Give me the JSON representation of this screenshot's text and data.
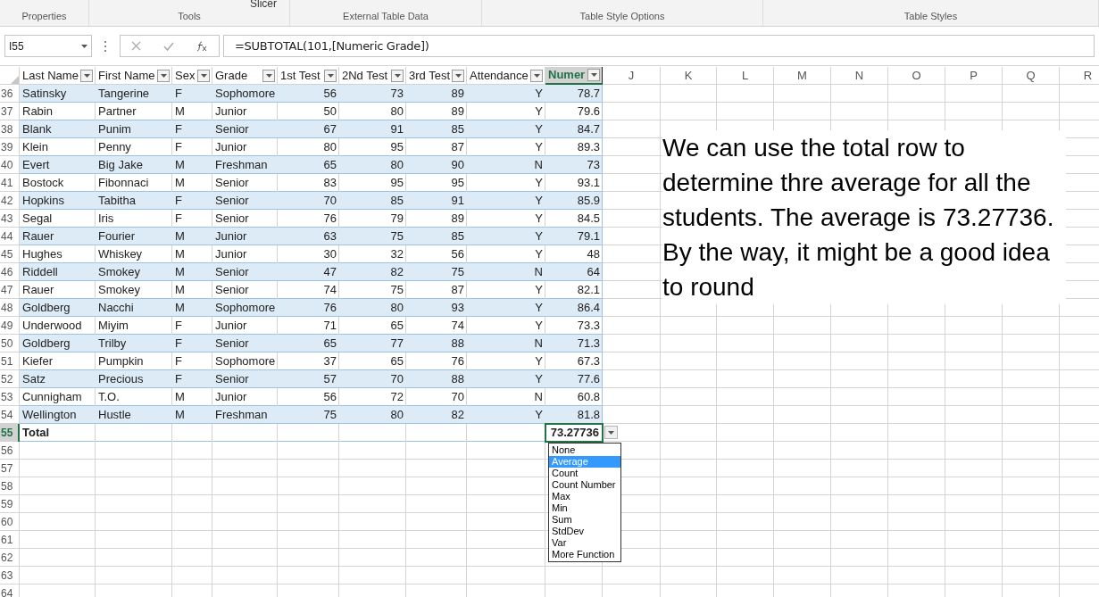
{
  "ribbon": {
    "slicer_label": "Slicer",
    "groups": [
      "Properties",
      "Tools",
      "External Table Data",
      "Table Style Options",
      "Table Styles"
    ]
  },
  "formula_bar": {
    "name_box": "I55",
    "formula": "=SUBTOTAL(101,[Numeric Grade])"
  },
  "columns": [
    {
      "label": "Last Name",
      "filter": true,
      "selected": false
    },
    {
      "label": "First Name",
      "filter": true,
      "selected": false
    },
    {
      "label": "Sex",
      "filter": true,
      "selected": false
    },
    {
      "label": "Grade",
      "filter": true,
      "selected": false
    },
    {
      "label": "1st Test",
      "filter": true,
      "selected": false
    },
    {
      "label": "2Nd Test",
      "filter": true,
      "selected": false
    },
    {
      "label": "3rd Test",
      "filter": true,
      "selected": false
    },
    {
      "label": "Attendance",
      "filter": true,
      "selected": false
    },
    {
      "label": "Numer",
      "filter": true,
      "selected": true
    },
    {
      "label": "J",
      "filter": false,
      "selected": false
    },
    {
      "label": "K",
      "filter": false,
      "selected": false
    },
    {
      "label": "L",
      "filter": false,
      "selected": false
    },
    {
      "label": "M",
      "filter": false,
      "selected": false
    },
    {
      "label": "N",
      "filter": false,
      "selected": false
    },
    {
      "label": "O",
      "filter": false,
      "selected": false
    },
    {
      "label": "P",
      "filter": false,
      "selected": false
    },
    {
      "label": "Q",
      "filter": false,
      "selected": false
    },
    {
      "label": "R",
      "filter": false,
      "selected": false
    }
  ],
  "rows": [
    {
      "num": "36",
      "cells": [
        "Satinsky",
        "Tangerine",
        "F",
        "Sophomore",
        "56",
        "73",
        "89",
        "Y",
        "78.7"
      ]
    },
    {
      "num": "37",
      "cells": [
        "Rabin",
        "Partner",
        "M",
        "Junior",
        "50",
        "80",
        "89",
        "Y",
        "79.6"
      ]
    },
    {
      "num": "38",
      "cells": [
        "Blank",
        "Punim",
        "F",
        "Senior",
        "67",
        "91",
        "85",
        "Y",
        "84.7"
      ]
    },
    {
      "num": "39",
      "cells": [
        "Klein",
        "Penny",
        "F",
        "Junior",
        "80",
        "95",
        "87",
        "Y",
        "89.3"
      ]
    },
    {
      "num": "40",
      "cells": [
        "Evert",
        "Big Jake",
        "M",
        "Freshman",
        "65",
        "80",
        "90",
        "N",
        "73"
      ]
    },
    {
      "num": "41",
      "cells": [
        "Bostock",
        "Fibonnaci",
        "M",
        "Senior",
        "83",
        "95",
        "95",
        "Y",
        "93.1"
      ]
    },
    {
      "num": "42",
      "cells": [
        "Hopkins",
        "Tabitha",
        "F",
        "Senior",
        "70",
        "85",
        "91",
        "Y",
        "85.9"
      ]
    },
    {
      "num": "43",
      "cells": [
        "Segal",
        "Iris",
        "F",
        "Senior",
        "76",
        "79",
        "89",
        "Y",
        "84.5"
      ]
    },
    {
      "num": "44",
      "cells": [
        "Rauer",
        "Fourier",
        "M",
        "Junior",
        "63",
        "75",
        "85",
        "Y",
        "79.1"
      ]
    },
    {
      "num": "45",
      "cells": [
        "Hughes",
        "Whiskey",
        "M",
        "Junior",
        "30",
        "32",
        "56",
        "Y",
        "48"
      ]
    },
    {
      "num": "46",
      "cells": [
        "Riddell",
        "Smokey",
        "M",
        "Senior",
        "47",
        "82",
        "75",
        "N",
        "64"
      ]
    },
    {
      "num": "47",
      "cells": [
        "Rauer",
        "Smokey",
        "M",
        "Senior",
        "74",
        "75",
        "87",
        "Y",
        "82.1"
      ]
    },
    {
      "num": "48",
      "cells": [
        "Goldberg",
        "Nacchi",
        "M",
        "Sophomore",
        "76",
        "80",
        "93",
        "Y",
        "86.4"
      ]
    },
    {
      "num": "49",
      "cells": [
        "Underwood",
        "Miyim",
        "F",
        "Junior",
        "71",
        "65",
        "74",
        "Y",
        "73.3"
      ]
    },
    {
      "num": "50",
      "cells": [
        "Goldberg",
        "Trilby",
        "F",
        "Senior",
        "65",
        "77",
        "88",
        "N",
        "71.3"
      ]
    },
    {
      "num": "51",
      "cells": [
        "Kiefer",
        "Pumpkin",
        "F",
        "Sophomore",
        "37",
        "65",
        "76",
        "Y",
        "67.3"
      ]
    },
    {
      "num": "52",
      "cells": [
        "Satz",
        "Precious",
        "F",
        "Senior",
        "57",
        "70",
        "88",
        "Y",
        "77.6"
      ]
    },
    {
      "num": "53",
      "cells": [
        "Cunnigham",
        "T.O.",
        "M",
        "Junior",
        "56",
        "72",
        "70",
        "N",
        "60.8"
      ]
    },
    {
      "num": "54",
      "cells": [
        "Wellington",
        "Hustle",
        "M",
        "Freshman",
        "75",
        "80",
        "82",
        "Y",
        "81.8"
      ]
    }
  ],
  "total_row": {
    "num": "55",
    "label": "Total",
    "value": "73.27736",
    "selected": true
  },
  "function_menu": [
    {
      "label": "None",
      "selected": false
    },
    {
      "label": "Average",
      "selected": true
    },
    {
      "label": "Count",
      "selected": false
    },
    {
      "label": "Count Number",
      "selected": false
    },
    {
      "label": "Max",
      "selected": false
    },
    {
      "label": "Min",
      "selected": false
    },
    {
      "label": "Sum",
      "selected": false
    },
    {
      "label": "StdDev",
      "selected": false
    },
    {
      "label": "Var",
      "selected": false
    },
    {
      "label": "More Function",
      "selected": false
    }
  ],
  "empty_rows": [
    "56",
    "57",
    "58",
    "59",
    "60",
    "61",
    "62",
    "63",
    "64"
  ],
  "note": "We can use the total row to determine thre average for all the students. The average is 73.27736. By the way, it might be a good idea to round"
}
